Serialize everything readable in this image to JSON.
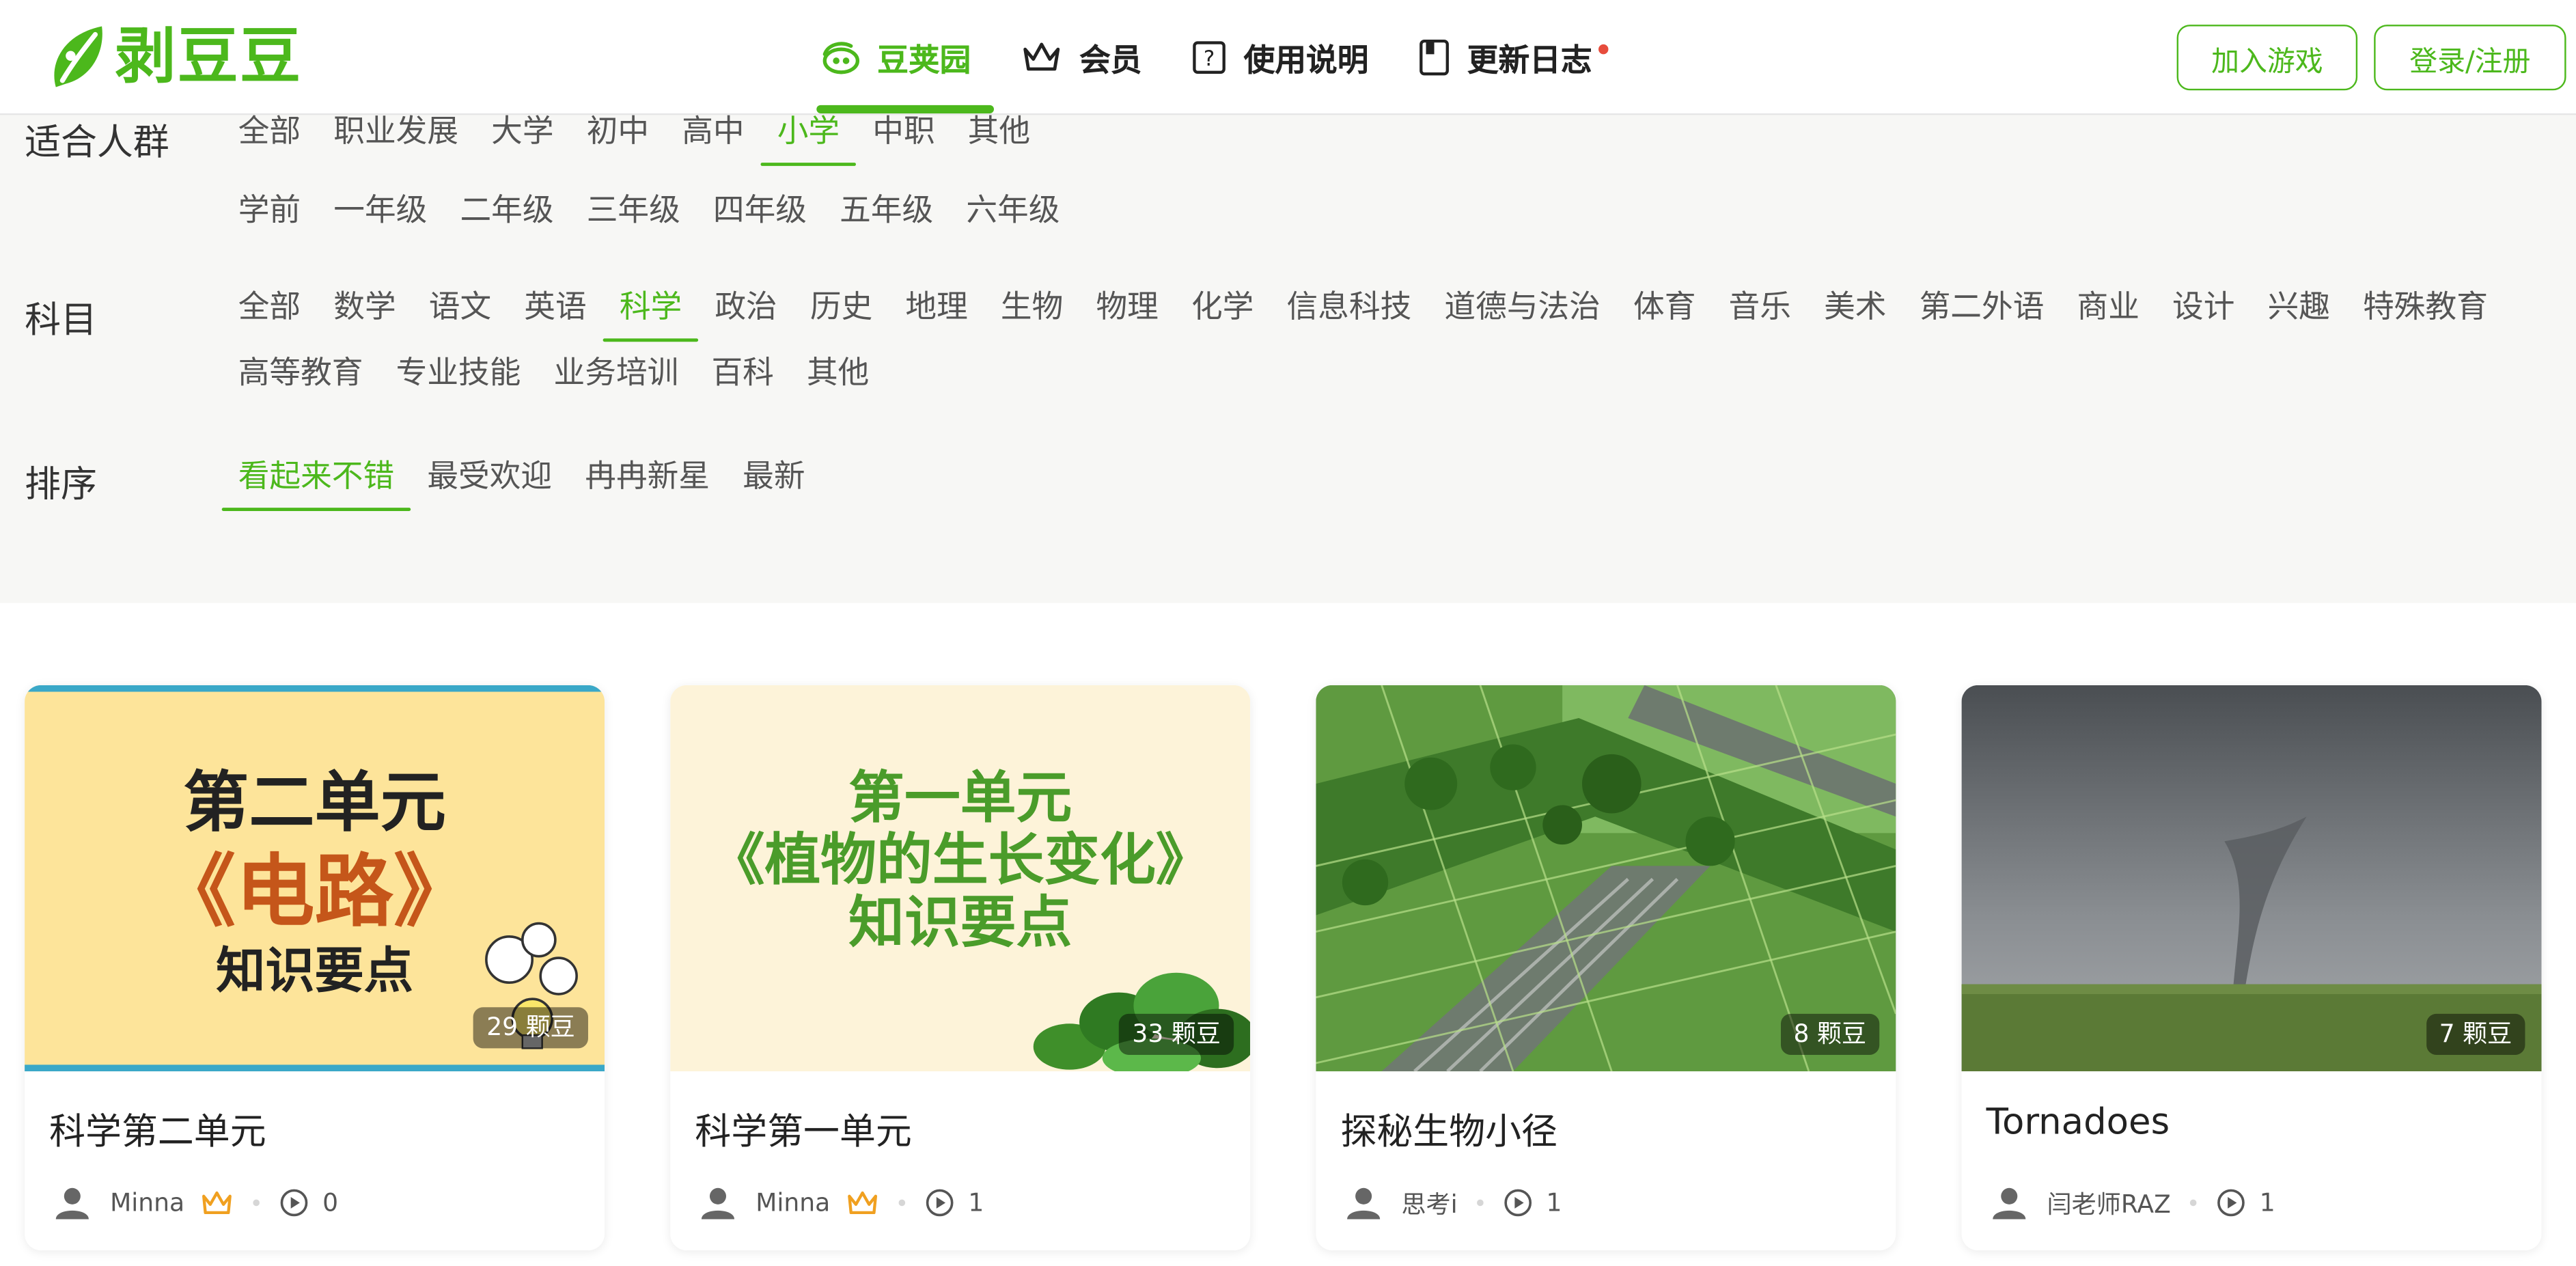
{
  "header": {
    "logo_text": "剥豆豆",
    "nav": [
      {
        "label": "豆荚园",
        "icon": "bean-pod-icon"
      },
      {
        "label": "会员",
        "icon": "crown-icon"
      },
      {
        "label": "使用说明",
        "icon": "help-icon"
      },
      {
        "label": "更新日志",
        "icon": "log-icon"
      }
    ],
    "join_game": "加入游戏",
    "login": "登录/注册"
  },
  "filters": {
    "audience": {
      "label": "适合人群",
      "row1": [
        "全部",
        "职业发展",
        "大学",
        "初中",
        "高中",
        "小学",
        "中职",
        "其他"
      ],
      "row2": [
        "学前",
        "一年级",
        "二年级",
        "三年级",
        "四年级",
        "五年级",
        "六年级"
      ],
      "active": "小学"
    },
    "subject": {
      "label": "科目",
      "options": [
        "全部",
        "数学",
        "语文",
        "英语",
        "科学",
        "政治",
        "历史",
        "地理",
        "生物",
        "物理",
        "化学",
        "信息科技",
        "道德与法治",
        "体育",
        "音乐",
        "美术",
        "第二外语",
        "商业",
        "设计",
        "兴趣",
        "特殊教育",
        "高等教育",
        "专业技能",
        "业务培训",
        "百科",
        "其他"
      ],
      "active": "科学"
    },
    "sort": {
      "label": "排序",
      "options": [
        "看起来不错",
        "最受欢迎",
        "冉冉新星",
        "最新"
      ],
      "active": "看起来不错"
    }
  },
  "cards": [
    {
      "title": "科学第二单元",
      "beans": "29 颗豆",
      "author": "Minna",
      "vip": true,
      "plays": "0",
      "thumb": {
        "line1": "第二单元",
        "line2": "《电路》",
        "line3": "知识要点"
      }
    },
    {
      "title": "科学第一单元",
      "beans": "33 颗豆",
      "author": "Minna",
      "vip": true,
      "plays": "1",
      "thumb": {
        "line1": "第一单元",
        "line2": "《植物的生长变化》",
        "line3": "知识要点"
      }
    },
    {
      "title": "探秘生物小径",
      "beans": "8 颗豆",
      "author": "思考i",
      "vip": false,
      "plays": "1"
    },
    {
      "title": "Tornadoes",
      "beans": "7 颗豆",
      "author": "闫老师RAZ",
      "vip": false,
      "plays": "1"
    }
  ],
  "colors": {
    "accent": "#4cb81c",
    "filter_bg": "#f7f7f5",
    "notification_dot": "#e74c3c"
  }
}
